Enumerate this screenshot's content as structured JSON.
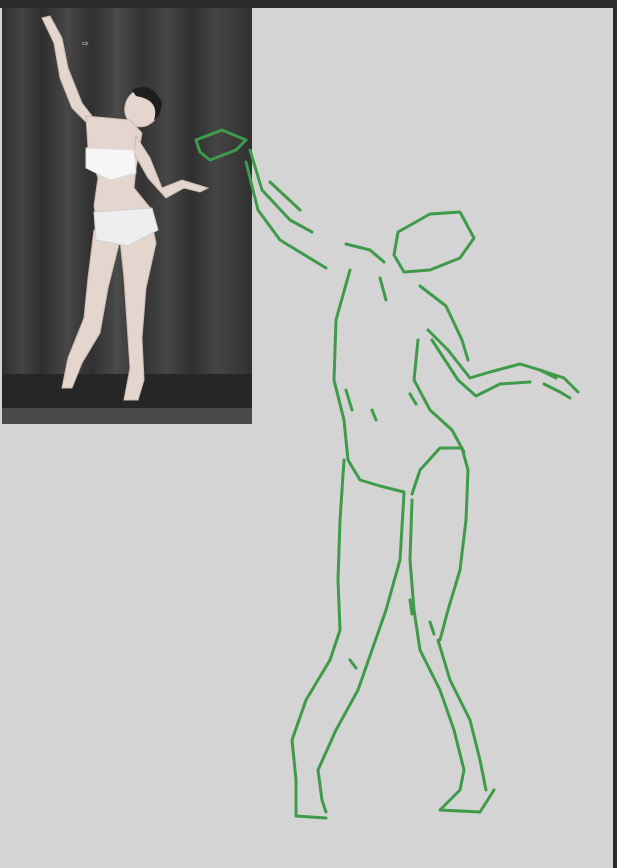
{
  "canvas": {
    "background": "#d4d4d4"
  },
  "reference_photo": {
    "backdrop": "#3a3a3a",
    "floor": "#2a2a2a",
    "figure_color": "#e6dcd6"
  },
  "sketch": {
    "stroke_color": "#3f9a4a"
  },
  "cursor": {
    "icon": "arrow-cursor-icon",
    "glyph": "⇨"
  }
}
